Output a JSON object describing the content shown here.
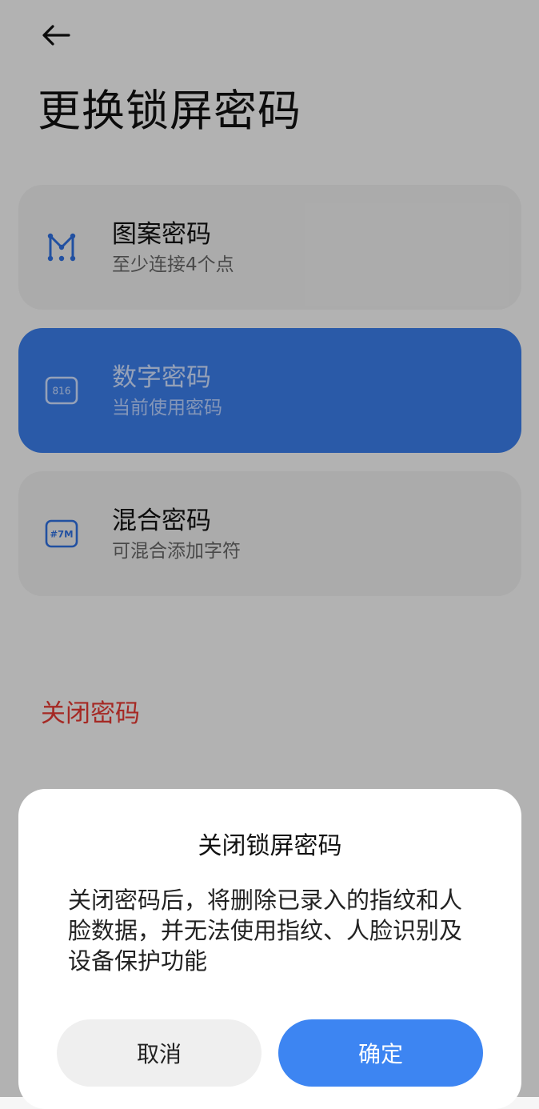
{
  "header": {
    "back": "back-arrow",
    "title": "更换锁屏密码"
  },
  "options": [
    {
      "title": "图案密码",
      "subtitle": "至少连接4个点",
      "icon": "pattern-icon",
      "selected": false
    },
    {
      "title": "数字密码",
      "subtitle": "当前使用密码",
      "icon": "number-icon",
      "icon_text": "816",
      "selected": true
    },
    {
      "title": "混合密码",
      "subtitle": "可混合添加字符",
      "icon": "mixed-icon",
      "icon_text": "#7M",
      "selected": false
    }
  ],
  "disable_label": "关闭密码",
  "dialog": {
    "title": "关闭锁屏密码",
    "message": "关闭密码后，将删除已录入的指纹和人脸数据，并无法使用指纹、人脸识别及设备保护功能",
    "cancel": "取消",
    "confirm": "确定"
  },
  "colors": {
    "accent": "#3b7de9",
    "danger": "#e53a33"
  }
}
